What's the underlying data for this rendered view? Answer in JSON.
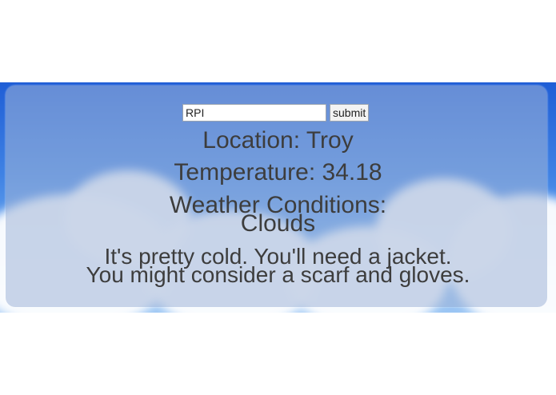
{
  "search": {
    "value": "RPI",
    "button_label": "submit"
  },
  "weather": {
    "location_line": "Location: Troy",
    "temperature_line": "Temperature: 34.18",
    "conditions_label": "Weather Conditions:",
    "conditions_value": "Clouds",
    "advice_line_1": "It's pretty cold. You'll need a jacket.",
    "advice_line_2": "You might consider a scarf and gloves."
  },
  "colors": {
    "text": "#3d3d3d",
    "sky": "#3f82e4",
    "panel": "#a0b4d7"
  }
}
